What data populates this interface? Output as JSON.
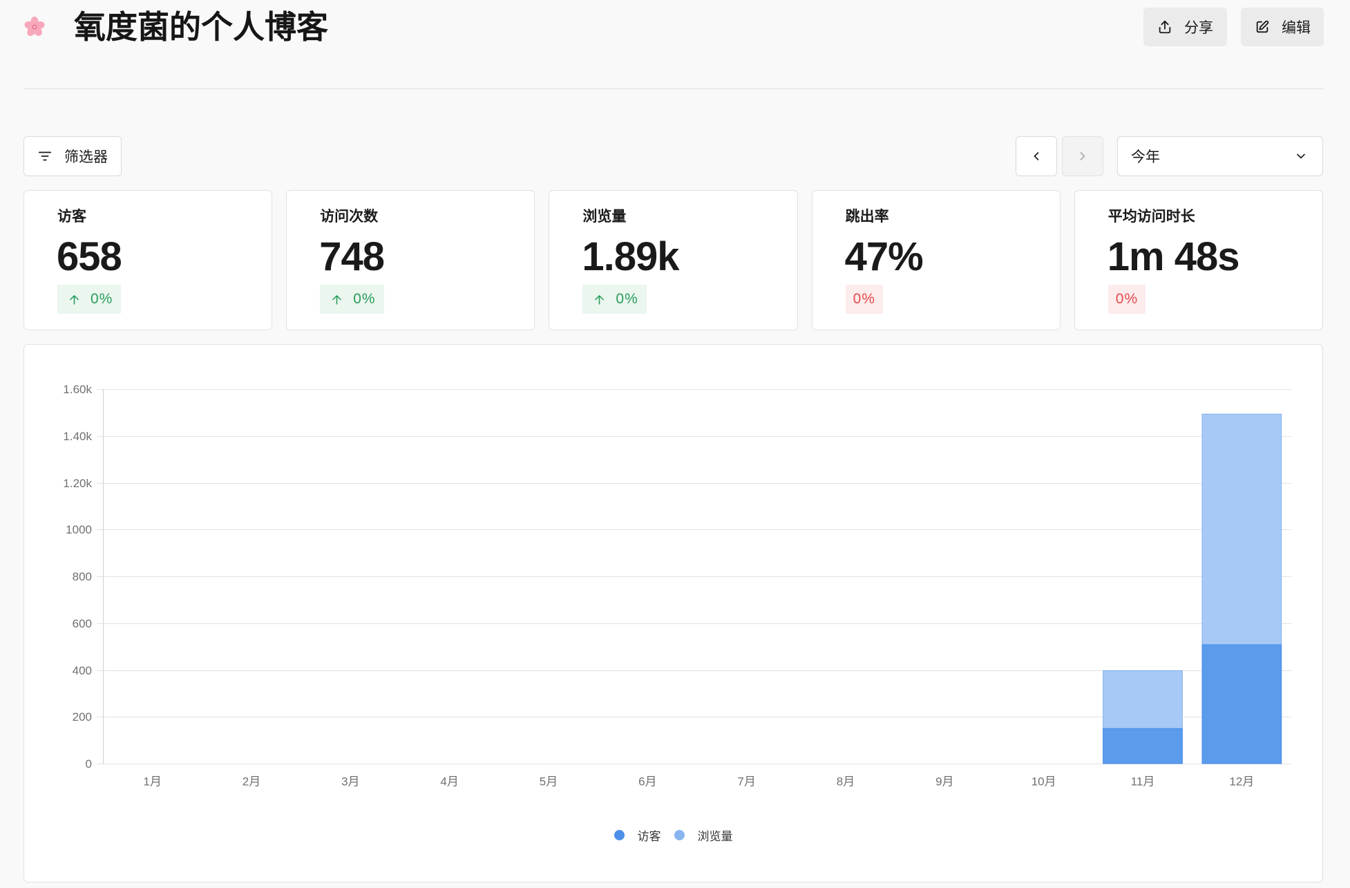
{
  "header": {
    "logo_icon": "sakura-icon",
    "title": "氧度菌的个人博客",
    "share": {
      "icon": "share-icon",
      "label": "分享"
    },
    "edit": {
      "icon": "edit-icon",
      "label": "编辑"
    }
  },
  "toolbar": {
    "filter": {
      "icon": "filter-icon",
      "label": "筛选器"
    },
    "prev_icon": "chevron-left-icon",
    "next_icon": "chevron-right-icon",
    "date_range": {
      "value": "今年",
      "icon": "chevron-down-icon"
    }
  },
  "stats": [
    {
      "label": "访客",
      "value": "658",
      "change": "0%",
      "change_icon": "arrow-up-icon",
      "change_color": "#2A9D5C",
      "change_bg": "#EAF6EE"
    },
    {
      "label": "访问次数",
      "value": "748",
      "change": "0%",
      "change_icon": "arrow-up-icon",
      "change_color": "#2A9D5C",
      "change_bg": "#EAF6EE"
    },
    {
      "label": "浏览量",
      "value": "1.89k",
      "change": "0%",
      "change_icon": "arrow-up-icon",
      "change_color": "#2A9D5C",
      "change_bg": "#EAF6EE"
    },
    {
      "label": "跳出率",
      "value": "47%",
      "change": "0%",
      "change_icon": "",
      "change_color": "#E5484D",
      "change_bg": "#FDECEC"
    },
    {
      "label": "平均访问时长",
      "value": "1m 48s",
      "change": "0%",
      "change_icon": "",
      "change_color": "#E5484D",
      "change_bg": "#FDECEC"
    }
  ],
  "chart_data": {
    "type": "bar",
    "categories": [
      "1月",
      "2月",
      "3月",
      "4月",
      "5月",
      "6月",
      "7月",
      "8月",
      "9月",
      "10月",
      "11月",
      "12月"
    ],
    "series": [
      {
        "name": "访客",
        "values": [
          0,
          0,
          0,
          0,
          0,
          0,
          0,
          0,
          0,
          0,
          150,
          508
        ],
        "color": "#5A9BEB",
        "border_color": "#4A8FE8",
        "legend_color": "#4B8FE9"
      },
      {
        "name": "浏览量",
        "values": [
          0,
          0,
          0,
          0,
          0,
          0,
          0,
          0,
          0,
          0,
          397,
          1493
        ],
        "color": "#A8C9F5",
        "border_color": "#7FAEEE",
        "legend_color": "#88B5F0"
      }
    ],
    "yticks": [
      0,
      200,
      400,
      600,
      800,
      1000,
      1200,
      1400,
      1600
    ],
    "ytick_labels": [
      "0",
      "200",
      "400",
      "600",
      "800",
      "1000",
      "1.20k",
      "1.40k",
      "1.60k"
    ],
    "ylim": [
      0,
      1600
    ],
    "overlap": true,
    "grid": true,
    "legend": "bottom"
  }
}
